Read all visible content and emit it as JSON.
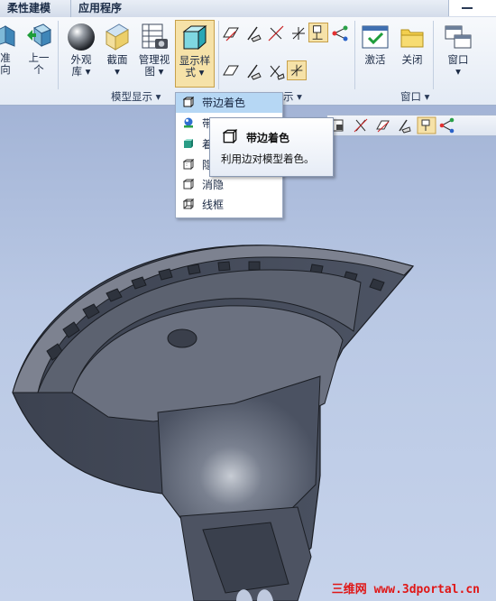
{
  "tabs": [
    {
      "label": "柔性建模"
    },
    {
      "label": "应用程序"
    }
  ],
  "ribbon": {
    "buttons": {
      "standard_orientation": "准\n向",
      "previous": "上一\n个",
      "appearance": "外观\n库 ▾",
      "section": "截面\n▾",
      "manage_views": "管理视\n图 ▾",
      "display_style": "显示样\n式 ▾",
      "activate": "激活",
      "close": "关闭",
      "window": "窗口\n▾"
    },
    "groups": {
      "model_display": "模型显示 ▾",
      "display": "示 ▾",
      "window": "窗口 ▾"
    }
  },
  "display_style_menu": {
    "items": [
      {
        "label": "带边着色",
        "icon": "shaded-with-edges-icon",
        "selected": true
      },
      {
        "label": "带",
        "icon": "shaded-with-reflections-icon",
        "selected": false
      },
      {
        "label": "着",
        "icon": "shaded-icon",
        "selected": false
      },
      {
        "label": "隐",
        "icon": "hidden-line-icon",
        "selected": false
      },
      {
        "label": "消隐",
        "icon": "no-hidden-icon",
        "selected": false
      },
      {
        "label": "线框",
        "icon": "wireframe-icon",
        "selected": false
      }
    ]
  },
  "tooltip": {
    "title": "带边着色",
    "description": "利用边对模型着色。"
  },
  "watermark": "三维网 www.3dportal.cn",
  "colors": {
    "selection": "#b6d7f4",
    "viewport_top": "#a3b4d6",
    "model_fill": "#4a5160",
    "watermark": "#e01616"
  }
}
